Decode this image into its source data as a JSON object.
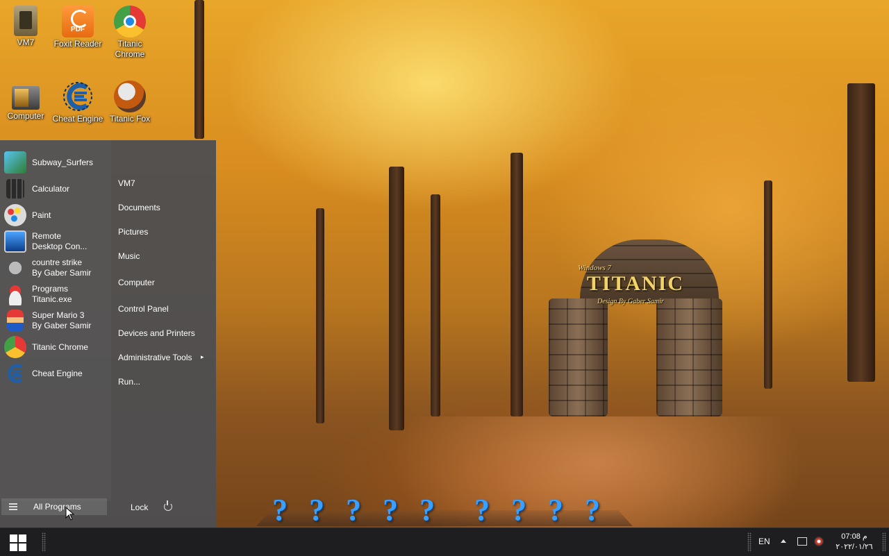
{
  "wallpaper": {
    "brand_top": "Windows 7",
    "brand": "TITANIC",
    "brand_sub": "Design By Gaber Samir"
  },
  "desktop_icons": [
    {
      "label": "VM7",
      "icon": "vm7-icon"
    },
    {
      "label": "Foxit Reader",
      "icon": "pdf-icon",
      "badge": "PDF"
    },
    {
      "label": "Titanic Chrome",
      "icon": "chrome-icon"
    },
    {
      "label": "Computer",
      "icon": "computer-icon"
    },
    {
      "label": "Cheat Engine",
      "icon": "cheat-engine-icon"
    },
    {
      "label": "Titanic Fox",
      "icon": "firefox-icon"
    }
  ],
  "start_menu": {
    "programs": [
      {
        "line1": "Subway_Surfers",
        "line2": "",
        "icon": "subway-surfers-icon"
      },
      {
        "line1": "Calculator",
        "line2": "",
        "icon": "calculator-icon"
      },
      {
        "line1": "Paint",
        "line2": "",
        "icon": "paint-icon"
      },
      {
        "line1": "Remote",
        "line2": "Desktop Con...",
        "icon": "remote-desktop-icon"
      },
      {
        "line1": "countre strike",
        "line2": "By Gaber Samir",
        "icon": "counter-strike-icon"
      },
      {
        "line1": "Programs",
        "line2": "Titanic.exe",
        "icon": "titanic-programs-icon"
      },
      {
        "line1": "Super Mario 3",
        "line2": "By Gaber Samir",
        "icon": "mario-icon"
      },
      {
        "line1": "Titanic Chrome",
        "line2": "",
        "icon": "chrome-icon"
      },
      {
        "line1": "Cheat Engine",
        "line2": "",
        "icon": "cheat-engine-icon"
      }
    ],
    "places": [
      "VM7",
      "Documents",
      "Pictures",
      "Music",
      "Computer",
      "Control Panel",
      "Devices and Printers",
      "Administrative Tools",
      "Run..."
    ],
    "submenu_arrow": "▸",
    "all_programs": "All Programs",
    "lock": "Lock"
  },
  "dock": {
    "items": [
      "?",
      "?",
      "?",
      "?",
      "?",
      "?",
      "?",
      "?",
      "?"
    ],
    "color": "#3aa0ff"
  },
  "taskbar": {
    "language": "EN",
    "time": "07:08 م",
    "date": "٢٠٢٢/٠١/٢٦"
  }
}
